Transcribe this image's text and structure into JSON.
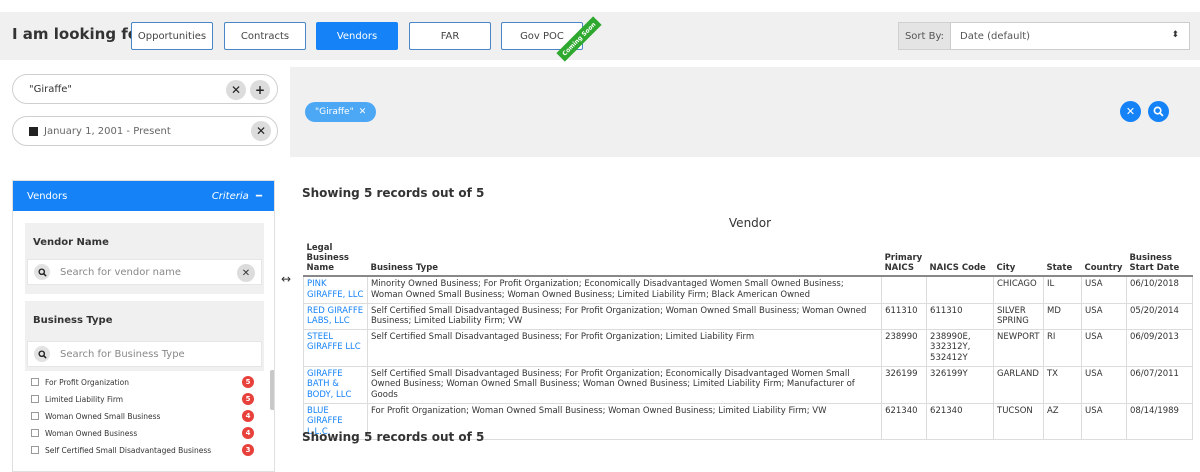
{
  "header": {
    "looking_label": "I am looking for ...",
    "tabs": [
      {
        "label": "Opportunities",
        "active": false
      },
      {
        "label": "Contracts",
        "active": false
      },
      {
        "label": "Vendors",
        "active": true
      },
      {
        "label": "FAR",
        "active": false
      },
      {
        "label": "Gov POC",
        "active": false
      }
    ],
    "ribbon": "Coming Soon",
    "sort_label": "Sort By:",
    "sort_value": "Date (default)"
  },
  "search": {
    "keyword": "\"Giraffe\"",
    "date_range": "January 1, 2001 - Present",
    "chip": "\"Giraffe\""
  },
  "criteria": {
    "title": "Vendors",
    "criteria_label": "Criteria",
    "vendor_name": {
      "title": "Vendor Name",
      "placeholder": "Search for vendor name"
    },
    "business_type": {
      "title": "Business Type",
      "placeholder": "Search for Business Type"
    },
    "options": [
      {
        "label": "For Profit Organization",
        "count": "5"
      },
      {
        "label": "Limited Liability Firm",
        "count": "5"
      },
      {
        "label": "Woman Owned Small Business",
        "count": "4"
      },
      {
        "label": "Woman Owned Business",
        "count": "4"
      },
      {
        "label": "Self Certified Small Disadvantaged Business",
        "count": "3"
      }
    ]
  },
  "results": {
    "showing": "Showing 5 records out of 5",
    "title": "Vendor",
    "columns": [
      "Legal Business Name",
      "Business Type",
      "Primary NAICS",
      "NAICS Code",
      "City",
      "State",
      "Country",
      "Business Start Date"
    ],
    "rows": [
      [
        "PINK GIRAFFE, LLC",
        "Minority Owned Business; For Profit Organization; Economically Disadvantaged Women Small Owned Business; Woman Owned Small Business; Woman Owned Business; Limited Liability Firm; Black American Owned",
        "",
        "",
        "CHICAGO",
        "IL",
        "USA",
        "06/10/2018"
      ],
      [
        "RED GIRAFFE LABS, LLC",
        "Self Certified Small Disadvantaged Business; For Profit Organization; Woman Owned Small Business; Woman Owned Business; Limited Liability Firm; VW",
        "611310",
        "611310",
        "SILVER SPRING",
        "MD",
        "USA",
        "05/20/2014"
      ],
      [
        "STEEL GIRAFFE LLC",
        "Self Certified Small Disadvantaged Business; For Profit Organization; Limited Liability Firm",
        "238990",
        "238990E, 332312Y, 532412Y",
        "NEWPORT",
        "RI",
        "USA",
        "06/09/2013"
      ],
      [
        "GIRAFFE BATH & BODY, LLC",
        "Self Certified Small Disadvantaged Business; For Profit Organization; Economically Disadvantaged Women Small Owned Business; Woman Owned Small Business; Woman Owned Business; Limited Liability Firm; Manufacturer of Goods",
        "326199",
        "326199Y",
        "GARLAND",
        "TX",
        "USA",
        "06/07/2011"
      ],
      [
        "BLUE GIRAFFE L.L.C.",
        "For Profit Organization; Woman Owned Small Business; Woman Owned Business; Limited Liability Firm; VW",
        "621340",
        "621340",
        "TUCSON",
        "AZ",
        "USA",
        "08/14/1989"
      ]
    ]
  }
}
